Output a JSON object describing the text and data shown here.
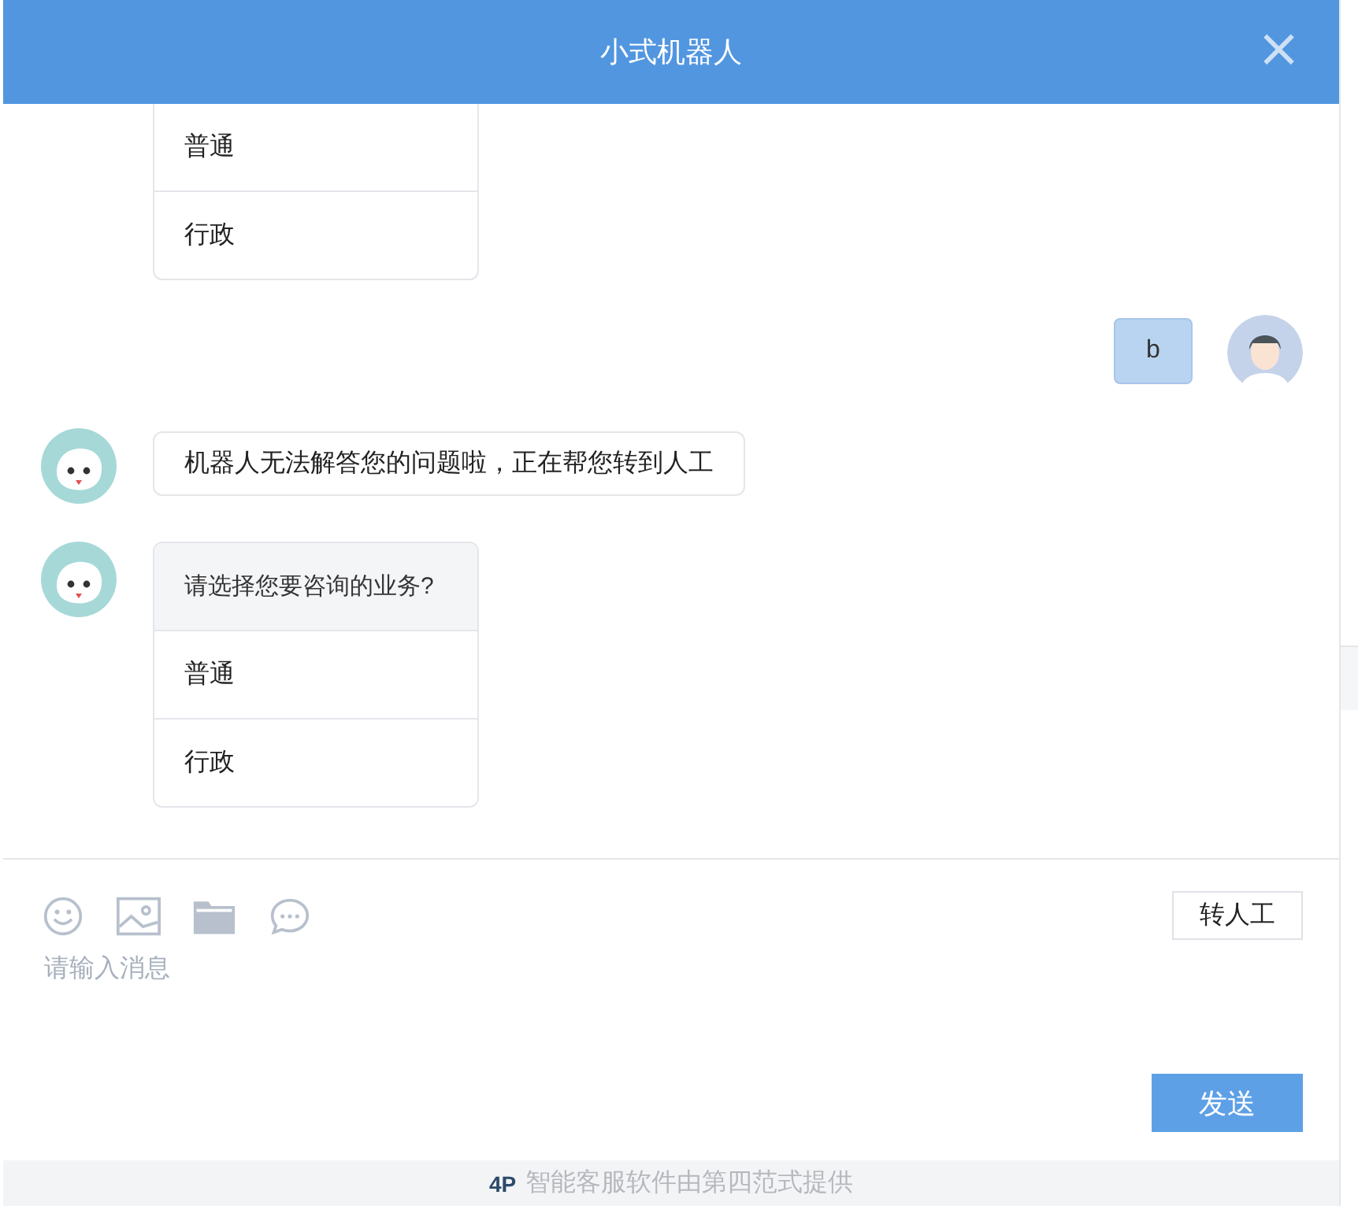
{
  "window": {
    "title": "小式机器人",
    "close": "×"
  },
  "messages": [
    {
      "kind": "options_card",
      "options": [
        "普通",
        "行政"
      ]
    },
    {
      "kind": "user_text",
      "text": "b"
    },
    {
      "kind": "bot_text",
      "text": "机器人无法解答您的问题啦，正在帮您转到人工"
    },
    {
      "kind": "options_card",
      "question": "请选择您要咨询的业务?",
      "options": [
        "普通",
        "行政"
      ]
    }
  ],
  "composer": {
    "placeholder": "请输入消息",
    "transfer_button": "转人工",
    "send_button": "发送"
  },
  "footer": {
    "logo": "4P",
    "text": "智能客服软件由第四范式提供"
  }
}
